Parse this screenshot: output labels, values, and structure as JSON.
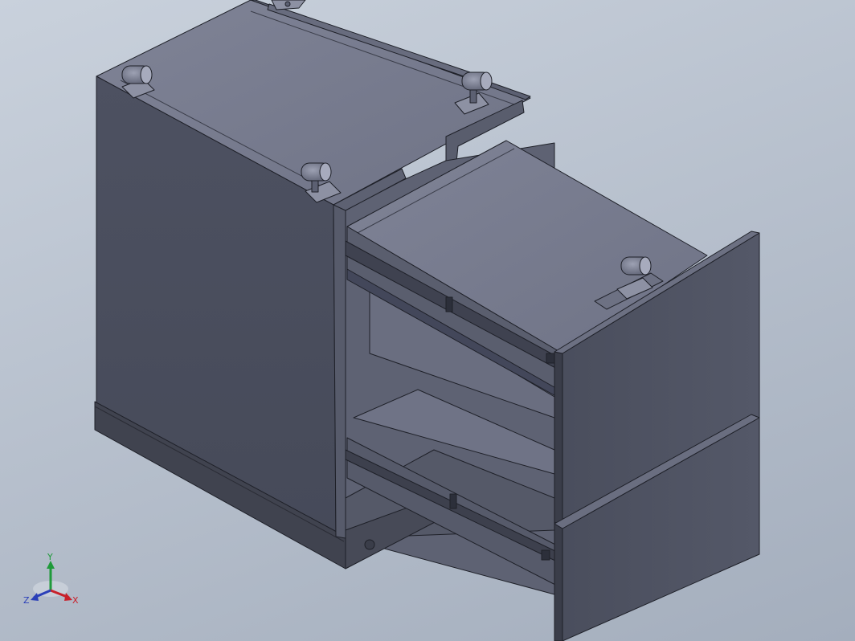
{
  "viewport": {
    "background_top": "#c9d1dc",
    "background_bottom": "#a4aebd"
  },
  "colors": {
    "face_dark": "#4b4f5e",
    "face_mid": "#5a5e6e",
    "face_top": "#7b7f91",
    "edge": "#1e2028",
    "rail": "#3c3f4b"
  },
  "triad": {
    "x_label": "X",
    "y_label": "Y",
    "z_label": "Z",
    "x_color": "#c8202a",
    "y_color": "#1f9a3a",
    "z_color": "#2a3fb8"
  }
}
